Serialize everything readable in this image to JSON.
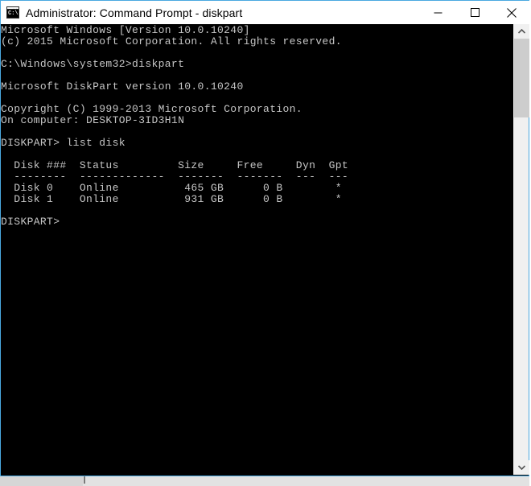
{
  "window": {
    "title": "Administrator: Command Prompt - diskpart",
    "icon_name": "command-prompt-icon",
    "icon_glyph": "C:\\.",
    "controls": {
      "minimize_label": "Minimize",
      "maximize_label": "Maximize",
      "close_label": "Close"
    },
    "colors": {
      "border": "#4aa8e0",
      "titlebar_bg": "#ffffff",
      "titlebar_fg": "#000000",
      "console_bg": "#000000",
      "console_fg": "#c6c6c6",
      "scrollbar_track": "#f0f0f0",
      "scrollbar_thumb": "#cdcdcd"
    }
  },
  "console": {
    "lines": [
      "Microsoft Windows [Version 10.0.10240]",
      "(c) 2015 Microsoft Corporation. All rights reserved.",
      "",
      "C:\\Windows\\system32>diskpart",
      "",
      "Microsoft DiskPart version 10.0.10240",
      "",
      "Copyright (C) 1999-2013 Microsoft Corporation.",
      "On computer: DESKTOP-3ID3H1N",
      "",
      "DISKPART> list disk",
      "",
      "  Disk ###  Status         Size     Free     Dyn  Gpt",
      "  --------  -------------  -------  -------  ---  ---",
      "  Disk 0    Online          465 GB      0 B        *",
      "  Disk 1    Online          931 GB      0 B        *",
      "",
      "DISKPART>"
    ],
    "os_version": "10.0.10240",
    "copyright_year": "2015",
    "copyright_owner": "Microsoft Corporation. All rights reserved.",
    "current_directory": "C:\\Windows\\system32",
    "command_entered": "diskpart",
    "diskpart_version": "10.0.10240",
    "diskpart_copyright": "Copyright (C) 1999-2013 Microsoft Corporation.",
    "computer_name": "DESKTOP-3ID3H1N",
    "prompt": "DISKPART>",
    "last_command": "list disk",
    "table": {
      "headers": [
        "Disk ###",
        "Status",
        "Size",
        "Free",
        "Dyn",
        "Gpt"
      ],
      "rows": [
        {
          "disk": "Disk 0",
          "status": "Online",
          "size": "465 GB",
          "free": "0 B",
          "dyn": "",
          "gpt": "*"
        },
        {
          "disk": "Disk 1",
          "status": "Online",
          "size": "931 GB",
          "free": "0 B",
          "dyn": "",
          "gpt": "*"
        }
      ]
    }
  },
  "scrollbar": {
    "up_arrow": "˄",
    "down_arrow": "˅"
  }
}
